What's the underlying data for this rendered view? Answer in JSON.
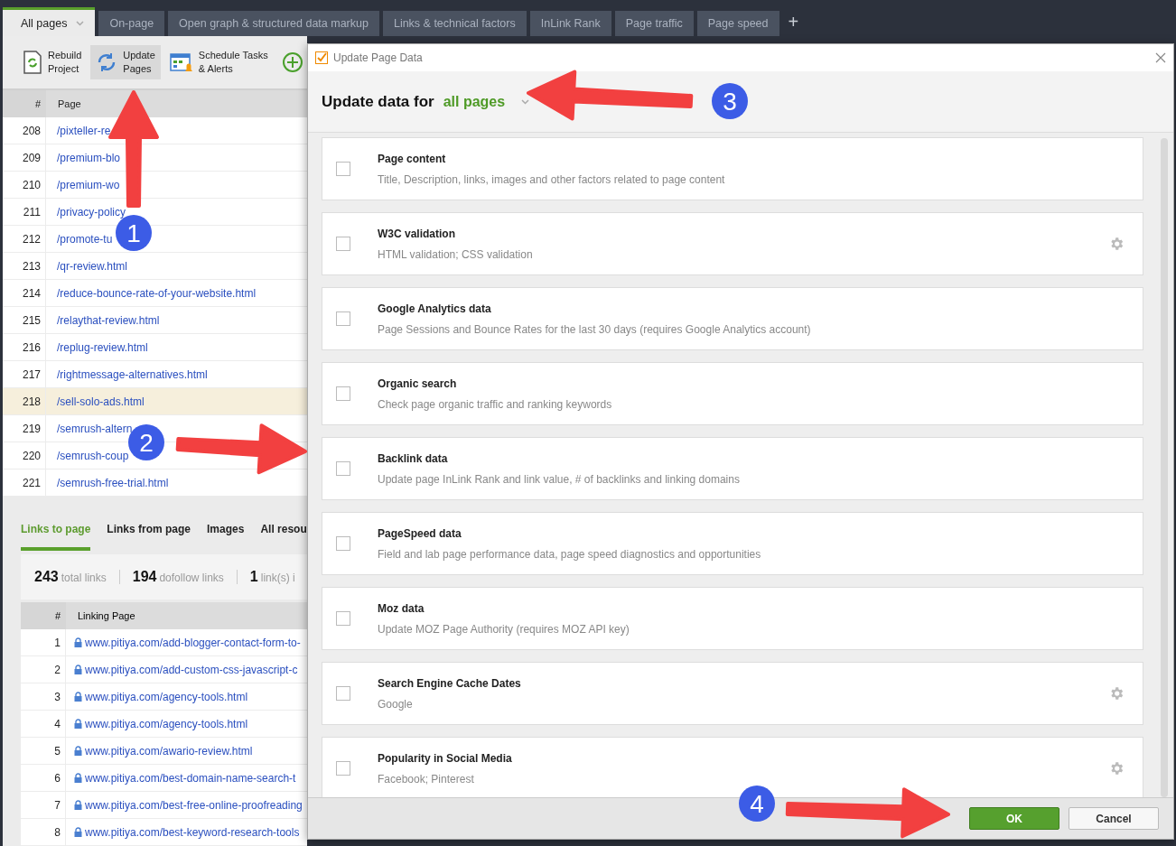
{
  "tabs": [
    {
      "label": "All pages",
      "selected": true,
      "dropdown": true
    },
    {
      "label": "On-page",
      "selected": false
    },
    {
      "label": "Open graph & structured data markup",
      "selected": false
    },
    {
      "label": "Links & technical factors",
      "selected": false
    },
    {
      "label": "InLink Rank",
      "selected": false
    },
    {
      "label": "Page traffic",
      "selected": false
    },
    {
      "label": "Page speed",
      "selected": false
    }
  ],
  "add_tab": "+",
  "toolbar": [
    {
      "kind": "rebuild",
      "label": "Rebuild\nProject",
      "selected": false
    },
    {
      "kind": "update",
      "label": "Update\nPages",
      "selected": true
    },
    {
      "kind": "schedule",
      "label": "Schedule Tasks\n& Alerts",
      "selected": false
    },
    {
      "kind": "add",
      "selected": false
    }
  ],
  "pages_table": {
    "columns": [
      "#",
      "Page"
    ],
    "rows": [
      {
        "num": "208",
        "page": "/pixteller-re",
        "selected": false
      },
      {
        "num": "209",
        "page": "/premium-blo",
        "selected": false
      },
      {
        "num": "210",
        "page": "/premium-wo",
        "selected": false
      },
      {
        "num": "211",
        "page": "/privacy-policy",
        "selected": false
      },
      {
        "num": "212",
        "page": "/promote-tu",
        "selected": false
      },
      {
        "num": "213",
        "page": "/qr-review.html",
        "selected": false
      },
      {
        "num": "214",
        "page": "/reduce-bounce-rate-of-your-website.html",
        "selected": false
      },
      {
        "num": "215",
        "page": "/relaythat-review.html",
        "selected": false
      },
      {
        "num": "216",
        "page": "/replug-review.html",
        "selected": false
      },
      {
        "num": "217",
        "page": "/rightmessage-alternatives.html",
        "selected": false
      },
      {
        "num": "218",
        "page": "/sell-solo-ads.html",
        "selected": true
      },
      {
        "num": "219",
        "page": "/semrush-altern",
        "selected": false
      },
      {
        "num": "220",
        "page": "/semrush-coup",
        "selected": false
      },
      {
        "num": "221",
        "page": "/semrush-free-trial.html",
        "selected": false
      }
    ]
  },
  "bottom_tabs": [
    {
      "label": "Links to page",
      "selected": true
    },
    {
      "label": "Links from page",
      "selected": false
    },
    {
      "label": "Images",
      "selected": false
    },
    {
      "label": "All resou",
      "selected": false
    }
  ],
  "stats": [
    {
      "value": "243",
      "label": "total links"
    },
    {
      "value": "194",
      "label": "dofollow links"
    },
    {
      "value": "1",
      "label": "link(s) i"
    }
  ],
  "links_table": {
    "columns": [
      "#",
      "Linking Page"
    ],
    "rows": [
      {
        "num": "1",
        "url": "www.pitiya.com/add-blogger-contact-form-to-"
      },
      {
        "num": "2",
        "url": "www.pitiya.com/add-custom-css-javascript-c"
      },
      {
        "num": "3",
        "url": "www.pitiya.com/agency-tools.html"
      },
      {
        "num": "4",
        "url": "www.pitiya.com/agency-tools.html"
      },
      {
        "num": "5",
        "url": "www.pitiya.com/awario-review.html"
      },
      {
        "num": "6",
        "url": "www.pitiya.com/best-domain-name-search-t"
      },
      {
        "num": "7",
        "url": "www.pitiya.com/best-free-online-proofreading"
      },
      {
        "num": "8",
        "url": "www.pitiya.com/best-keyword-research-tools"
      }
    ]
  },
  "dialog": {
    "title": "Update Page Data",
    "heading": "Update data for",
    "scope": "all pages",
    "options": [
      {
        "title": "Page content",
        "description": "Title, Description, links, images and other factors related to page content",
        "checked": false,
        "settings": false
      },
      {
        "title": "W3C validation",
        "description": "HTML validation; CSS validation",
        "checked": false,
        "settings": true
      },
      {
        "title": "Google Analytics data",
        "description": "Page Sessions and Bounce Rates for the last 30 days (requires Google Analytics account)",
        "checked": false,
        "settings": false
      },
      {
        "title": "Organic search",
        "description": "Check page organic traffic and ranking keywords",
        "checked": false,
        "settings": false
      },
      {
        "title": "Backlink data",
        "description": "Update page InLink Rank and link value, # of backlinks and linking domains",
        "checked": false,
        "settings": false
      },
      {
        "title": "PageSpeed data",
        "description": "Field and lab page performance data, page speed diagnostics and opportunities",
        "checked": false,
        "settings": false
      },
      {
        "title": "Moz data",
        "description": "Update MOZ Page Authority (requires MOZ API key)",
        "checked": false,
        "settings": false
      },
      {
        "title": "Search Engine Cache Dates",
        "description": "Google",
        "checked": false,
        "settings": true
      },
      {
        "title": "Popularity in Social Media",
        "description": "Facebook; Pinterest",
        "checked": false,
        "settings": true
      }
    ],
    "buttons": [
      {
        "kind": "primary",
        "label": "OK"
      },
      {
        "kind": "secondary",
        "label": "Cancel"
      }
    ]
  },
  "annotations": [
    {
      "number": "1"
    },
    {
      "number": "2"
    },
    {
      "number": "3"
    },
    {
      "number": "4"
    }
  ]
}
